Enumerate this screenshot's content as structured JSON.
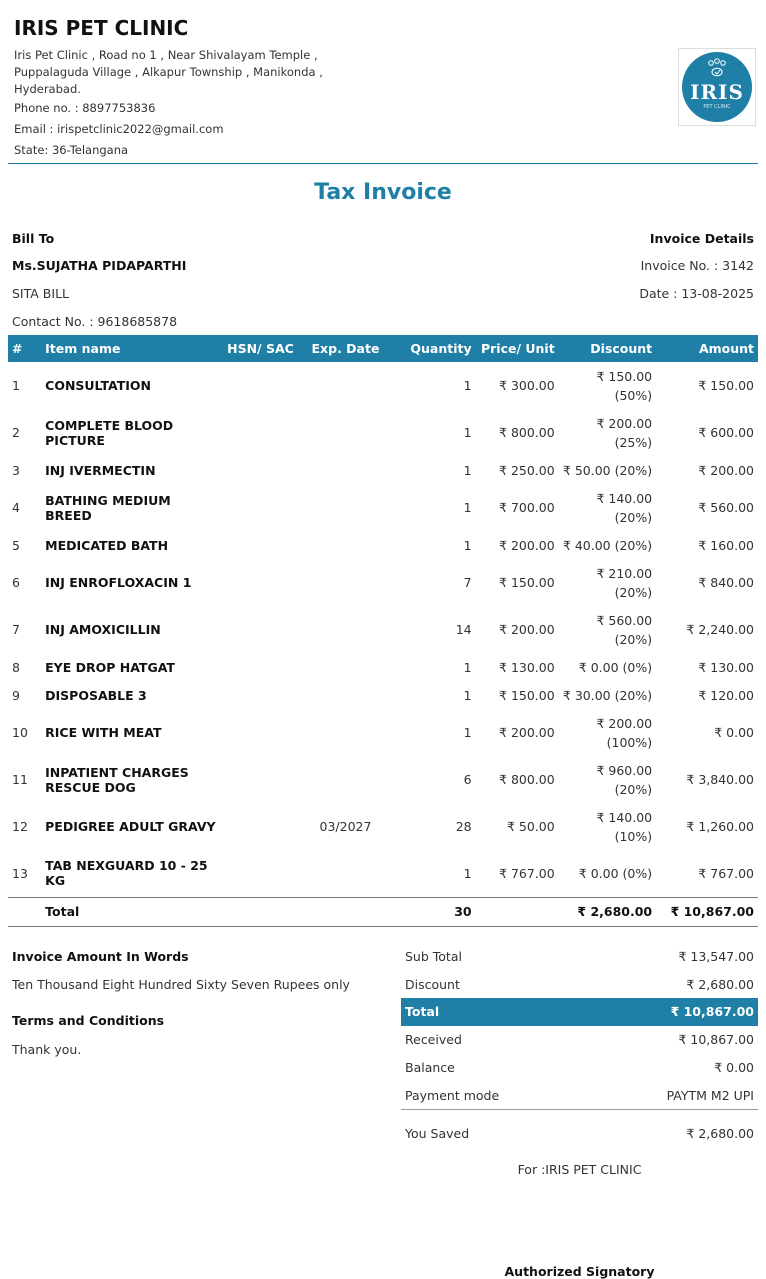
{
  "clinic": {
    "name": "IRIS PET CLINIC",
    "address": "Iris Pet Clinic , Road no 1 , Near Shivalayam Temple , Puppalaguda Village , Alkapur Township , Manikonda , Hyderabad.",
    "phone": "Phone no. : 8897753836",
    "email": "Email : irispetclinic2022@gmail.com",
    "state": "State: 36-Telangana",
    "logo_text": "IRIS",
    "logo_sub": "PET CLINIC"
  },
  "title": "Tax Invoice",
  "bill_to": {
    "heading": "Bill To",
    "name": "Ms.SUJATHA PIDAPARTHI",
    "line2": "SITA BILL",
    "contact": "Contact No. : 9618685878"
  },
  "invoice_details": {
    "heading": "Invoice Details",
    "number": "Invoice No. : 3142",
    "date": "Date : 13-08-2025"
  },
  "table": {
    "headers": [
      "#",
      "Item name",
      "HSN/ SAC",
      "Exp. Date",
      "Quantity",
      "Price/ Unit",
      "Discount",
      "Amount"
    ],
    "rows": [
      {
        "idx": "1",
        "name": "CONSULTATION",
        "hsn": "",
        "exp": "",
        "qty": "1",
        "price": "₹ 300.00",
        "disc": "₹ 150.00 (50%)",
        "amt": "₹ 150.00"
      },
      {
        "idx": "2",
        "name": "COMPLETE BLOOD PICTURE",
        "hsn": "",
        "exp": "",
        "qty": "1",
        "price": "₹ 800.00",
        "disc": "₹ 200.00 (25%)",
        "amt": "₹ 600.00"
      },
      {
        "idx": "3",
        "name": "INJ IVERMECTIN",
        "hsn": "",
        "exp": "",
        "qty": "1",
        "price": "₹ 250.00",
        "disc": "₹ 50.00 (20%)",
        "amt": "₹ 200.00"
      },
      {
        "idx": "4",
        "name": "BATHING MEDIUM BREED",
        "hsn": "",
        "exp": "",
        "qty": "1",
        "price": "₹ 700.00",
        "disc": "₹ 140.00 (20%)",
        "amt": "₹ 560.00"
      },
      {
        "idx": "5",
        "name": "MEDICATED BATH",
        "hsn": "",
        "exp": "",
        "qty": "1",
        "price": "₹ 200.00",
        "disc": "₹ 40.00 (20%)",
        "amt": "₹ 160.00"
      },
      {
        "idx": "6",
        "name": "INJ ENROFLOXACIN 1",
        "hsn": "",
        "exp": "",
        "qty": "7",
        "price": "₹ 150.00",
        "disc": "₹ 210.00 (20%)",
        "amt": "₹ 840.00"
      },
      {
        "idx": "7",
        "name": "INJ AMOXICILLIN",
        "hsn": "",
        "exp": "",
        "qty": "14",
        "price": "₹ 200.00",
        "disc": "₹ 560.00 (20%)",
        "amt": "₹ 2,240.00"
      },
      {
        "idx": "8",
        "name": "EYE DROP HATGAT",
        "hsn": "",
        "exp": "",
        "qty": "1",
        "price": "₹ 130.00",
        "disc": "₹ 0.00 (0%)",
        "amt": "₹ 130.00"
      },
      {
        "idx": "9",
        "name": "DISPOSABLE 3",
        "hsn": "",
        "exp": "",
        "qty": "1",
        "price": "₹ 150.00",
        "disc": "₹ 30.00 (20%)",
        "amt": "₹ 120.00"
      },
      {
        "idx": "10",
        "name": "RICE WITH MEAT",
        "hsn": "",
        "exp": "",
        "qty": "1",
        "price": "₹ 200.00",
        "disc": "₹ 200.00 (100%)",
        "amt": "₹ 0.00"
      },
      {
        "idx": "11",
        "name": "INPATIENT CHARGES RESCUE DOG",
        "hsn": "",
        "exp": "",
        "qty": "6",
        "price": "₹ 800.00",
        "disc": "₹ 960.00 (20%)",
        "amt": "₹ 3,840.00"
      },
      {
        "idx": "12",
        "name": "PEDIGREE ADULT GRAVY",
        "hsn": "",
        "exp": "03/2027",
        "qty": "28",
        "price": "₹ 50.00",
        "disc": "₹ 140.00 (10%)",
        "amt": "₹ 1,260.00"
      },
      {
        "idx": "13",
        "name": "TAB NEXGUARD 10 - 25 KG",
        "hsn": "",
        "exp": "",
        "qty": "1",
        "price": "₹ 767.00",
        "disc": "₹ 0.00 (0%)",
        "amt": "₹ 767.00"
      }
    ],
    "total": {
      "label": "Total",
      "qty": "30",
      "disc": "₹ 2,680.00",
      "amt": "₹ 10,867.00"
    }
  },
  "words": {
    "heading": "Invoice Amount In Words",
    "text": "Ten Thousand Eight Hundred Sixty Seven Rupees only"
  },
  "terms": {
    "heading": "Terms and Conditions",
    "text": "Thank you."
  },
  "summary": {
    "sub_total_label": "Sub Total",
    "sub_total": "₹ 13,547.00",
    "discount_label": "Discount",
    "discount": "₹ 2,680.00",
    "total_label": "Total",
    "total": "₹ 10,867.00",
    "received_label": "Received",
    "received": "₹ 10,867.00",
    "balance_label": "Balance",
    "balance": "₹ 0.00",
    "payment_label": "Payment mode",
    "payment": "PAYTM M2 UPI",
    "saved_label": "You Saved",
    "saved": "₹ 2,680.00"
  },
  "signature": {
    "for_text": "For :IRIS PET CLINIC",
    "label": "Authorized Signatory"
  },
  "colors": {
    "accent": "#1f7fa6"
  }
}
